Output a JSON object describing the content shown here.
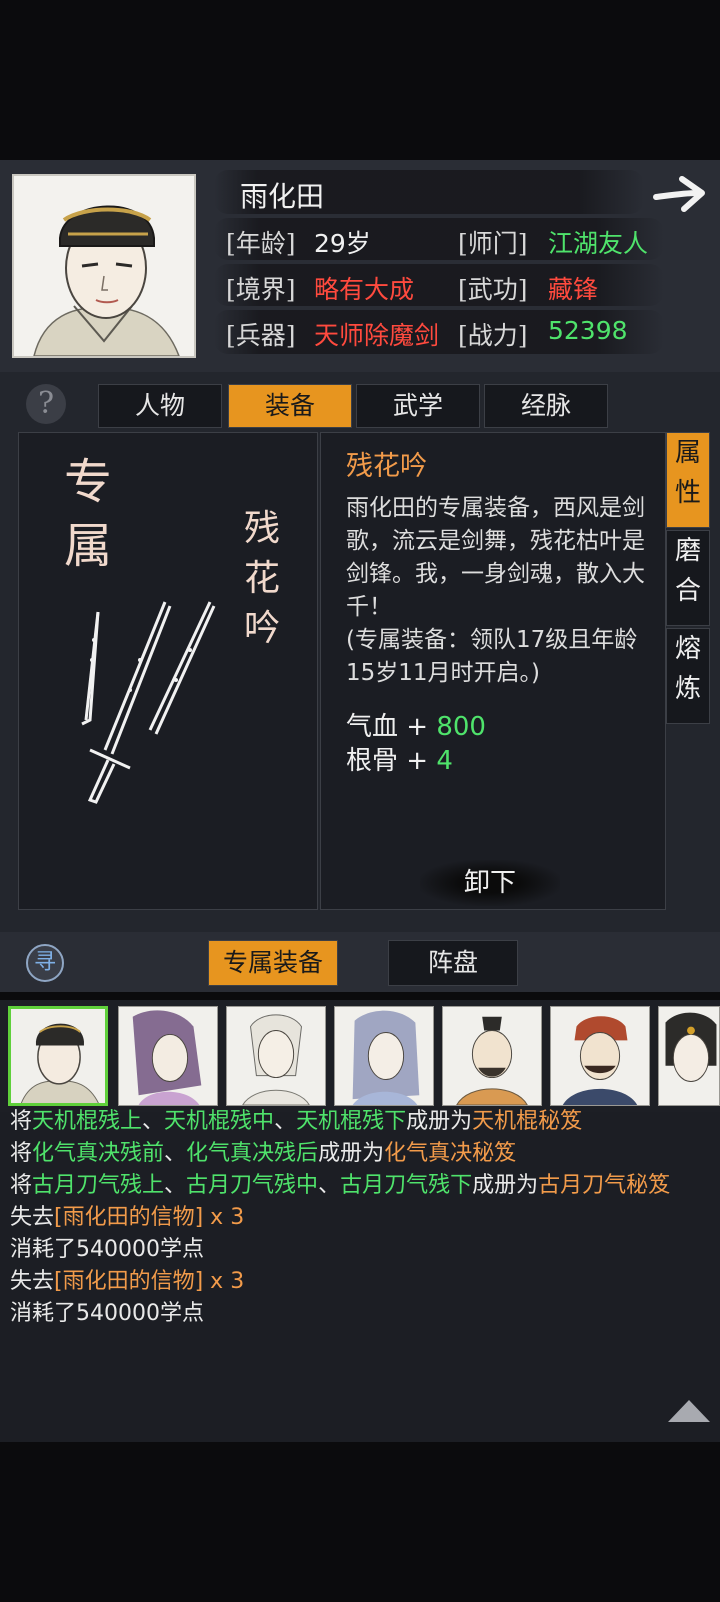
{
  "character": {
    "name": "雨化田",
    "age_label": "[年龄]",
    "age": "29岁",
    "sect_label": "[师门]",
    "sect": "江湖友人",
    "realm_label": "[境界]",
    "realm": "略有大成",
    "skill_label": "[武功]",
    "skill": "藏锋",
    "weapon_label": "[兵器]",
    "weapon": "天师除魔剑",
    "power_label": "[战力]",
    "power": "52398"
  },
  "tabs": [
    "人物",
    "装备",
    "武学",
    "经脉"
  ],
  "active_tab": "装备",
  "help_icon": "?",
  "equipment": {
    "type_label_1": "专",
    "type_label_2": "属",
    "item_vertical": [
      "残",
      "花",
      "吟"
    ],
    "title": "残花吟",
    "description": "雨化田的专属装备，西风是剑歌，流云是剑舞，残花枯叶是剑锋。我，一身剑魂，散入大千！",
    "unlock_note": "(专属装备：领队17级且年龄15岁11月时开启。)",
    "stats": [
      {
        "name": "气血",
        "op": "+",
        "value": "800"
      },
      {
        "name": "根骨",
        "op": "+",
        "value": "4"
      }
    ],
    "unequip_label": "卸下"
  },
  "side_tabs": [
    "属性",
    "磨合",
    "熔炼"
  ],
  "side_tab_chars": {
    "t1": [
      "属",
      "性"
    ],
    "t2": [
      "磨",
      "合"
    ],
    "t3": [
      "熔",
      "炼"
    ]
  },
  "bottom_tabs": [
    "专属装备",
    "阵盘"
  ],
  "search_icon": "寻",
  "roster_count": 7,
  "log": {
    "l1": {
      "a": "将",
      "b": "天机棍残上",
      "c": "、",
      "d": "天机棍残中",
      "e": "、",
      "f": "天机棍残下",
      "g": "成册为",
      "h": "天机棍秘笈"
    },
    "l2": {
      "a": "将",
      "b": "化气真决残前",
      "c": "、",
      "d": "化气真决残后",
      "e": "成册为",
      "f": "化气真决秘笈"
    },
    "l3": {
      "a": "将",
      "b": "古月刀气残上",
      "c": "、",
      "d": "古月刀气残中",
      "e": "、",
      "f": "古月刀气残下",
      "g": "成册为",
      "h": "古月刀气秘笈"
    },
    "l4": {
      "a": "失去",
      "b": "[雨化田的信物]",
      "c": " x 3"
    },
    "l5": "消耗了540000学点",
    "l6": {
      "a": "失去",
      "b": "[雨化田的信物]",
      "c": " x 3"
    },
    "l7": "消耗了540000学点"
  },
  "colors": {
    "accent": "#e7951f",
    "green": "#4fe36b",
    "red": "#ff4a3e",
    "orange": "#f29b4a"
  }
}
